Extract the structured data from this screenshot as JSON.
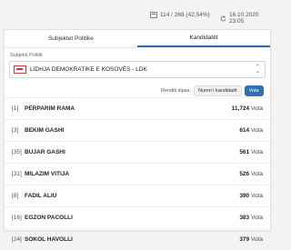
{
  "header": {
    "stations": "114 / 268 (42,54%)",
    "updated": "16.10.2020 23:05"
  },
  "tabs": [
    {
      "label": "Subjektet Politike"
    },
    {
      "label": "Kandidatët"
    }
  ],
  "filter": {
    "label": "Subjekti Politik",
    "selected": "LIDHJA DEMOKRATIKE E KOSOVËS - LDK"
  },
  "sort": {
    "label": "Renditi sipas:",
    "options": [
      "Numri i kandidatit",
      "Vota"
    ]
  },
  "candidates": [
    {
      "num": "[1]",
      "name": "PËRPARIM RAMA",
      "votes": "11,724",
      "unit": "Vota"
    },
    {
      "num": "[3]",
      "name": "BEKIM GASHI",
      "votes": "614",
      "unit": "Vota"
    },
    {
      "num": "[35]",
      "name": "BUJAR GASHI",
      "votes": "561",
      "unit": "Vota"
    },
    {
      "num": "[31]",
      "name": "MILAZIM VITIJA",
      "votes": "526",
      "unit": "Vota"
    },
    {
      "num": "[8]",
      "name": "FADIL ALIU",
      "votes": "390",
      "unit": "Vota"
    },
    {
      "num": "[16]",
      "name": "EGZON PACOLLI",
      "votes": "383",
      "unit": "Vota"
    },
    {
      "num": "[24]",
      "name": "SOKOL HAVOLLI",
      "votes": "379",
      "unit": "Vota"
    }
  ],
  "colors": {
    "accent": "#2f6fb3",
    "flag": "#c93a3a"
  }
}
